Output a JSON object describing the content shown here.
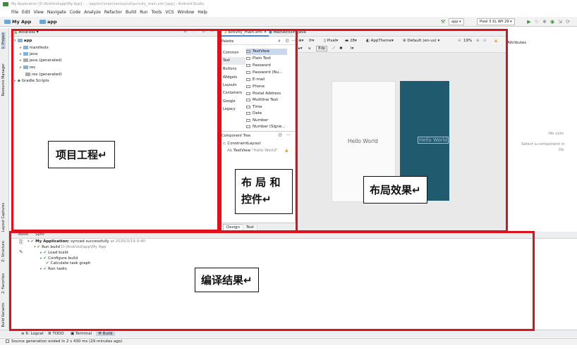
{
  "window": {
    "title": "My Application [D:\\Android\\app\\My App] - ...\\app\\src\\main\\res\\layout\\activity_main.xml [app] - Android Studio"
  },
  "menu": [
    "File",
    "Edit",
    "View",
    "Navigate",
    "Code",
    "Analyze",
    "Refactor",
    "Build",
    "Run",
    "Tools",
    "VCS",
    "Window",
    "Help"
  ],
  "nav": {
    "project": "My App",
    "module": "app",
    "run_config": "app",
    "device": "Pixel 3 XL API 29"
  },
  "side_tabs": {
    "project": "1: Project",
    "resource_manager": "Resource Manager",
    "layout_captures": "Layout Captures",
    "structure": "Z: Structure",
    "favorites": "2: Favorites",
    "build_variants": "Build Variants"
  },
  "project_panel": {
    "view_mode": "Android",
    "tree": [
      {
        "label": "app",
        "kind": "module"
      },
      {
        "label": "manifests",
        "kind": "folder"
      },
      {
        "label": "java",
        "kind": "folder"
      },
      {
        "label": "java (generated)",
        "kind": "folder"
      },
      {
        "label": "res",
        "kind": "folder"
      },
      {
        "label": "res (generated)",
        "kind": "folder"
      },
      {
        "label": "Gradle Scripts",
        "kind": "gradle"
      }
    ]
  },
  "editor_tabs": [
    {
      "label": "activity_main.xml",
      "active": true
    },
    {
      "label": "MainActivity.java",
      "active": false
    }
  ],
  "palette": {
    "title": "Palette",
    "categories": [
      "Common",
      "Text",
      "Buttons",
      "Widgets",
      "Layouts",
      "Containers",
      "Google",
      "Legacy"
    ],
    "selected_category": "Text",
    "items": [
      "TextView",
      "Plain Text",
      "Password",
      "Password (Nu...",
      "E-mail",
      "Phone",
      "Postal Address",
      "Multiline Text",
      "Time",
      "Date",
      "Number",
      "Number (Signe..."
    ]
  },
  "component_tree": {
    "title": "Component Tree",
    "root": "ConstraintLayout",
    "child_name": "TextView",
    "child_text": "\"Hello World\""
  },
  "design_tabs": [
    "Design",
    "Text"
  ],
  "design_toolbar": {
    "device": "Pixel",
    "api": "28",
    "theme": "AppTheme",
    "locale": "Default (en-us)",
    "zoom": "19%",
    "margin": "8dp",
    "attributes_label": "Attributes"
  },
  "preview": {
    "design_text": "Hello World",
    "blueprint_text": "Hello World"
  },
  "attributes_panel": {
    "line1": "No com",
    "line2": "Select a component in",
    "line3": "De"
  },
  "build_panel": {
    "tabs": [
      "Build",
      "Sync"
    ],
    "rows": [
      {
        "text": "My Application:",
        "suffix": " synced successfully",
        "time": " at 2020/3/19 9:40"
      },
      {
        "text": "Run build",
        "suffix": " D:\\Android\\app\\My App",
        "time": ""
      },
      {
        "text": "Load build",
        "suffix": "",
        "time": ""
      },
      {
        "text": "Configure build",
        "suffix": "",
        "time": ""
      },
      {
        "text": "Calculate task graph",
        "suffix": "",
        "time": ""
      },
      {
        "text": "Run tasks",
        "suffix": "",
        "time": ""
      }
    ]
  },
  "tool_windows": [
    "6: Logcat",
    "TODO",
    "Terminal",
    "Build"
  ],
  "status": "Source generation ended in 2 s 430 ms (29 minutes ago)",
  "annotations": {
    "project": "项目工程↵",
    "palette": "布 局 和",
    "palette_line2": "控件↵",
    "layout": "布局效果↵",
    "build": "编译结果↵"
  },
  "colors": {
    "highlight": "#e2101a",
    "blueprint": "#1f5a6e",
    "success": "#2e9b2e"
  }
}
